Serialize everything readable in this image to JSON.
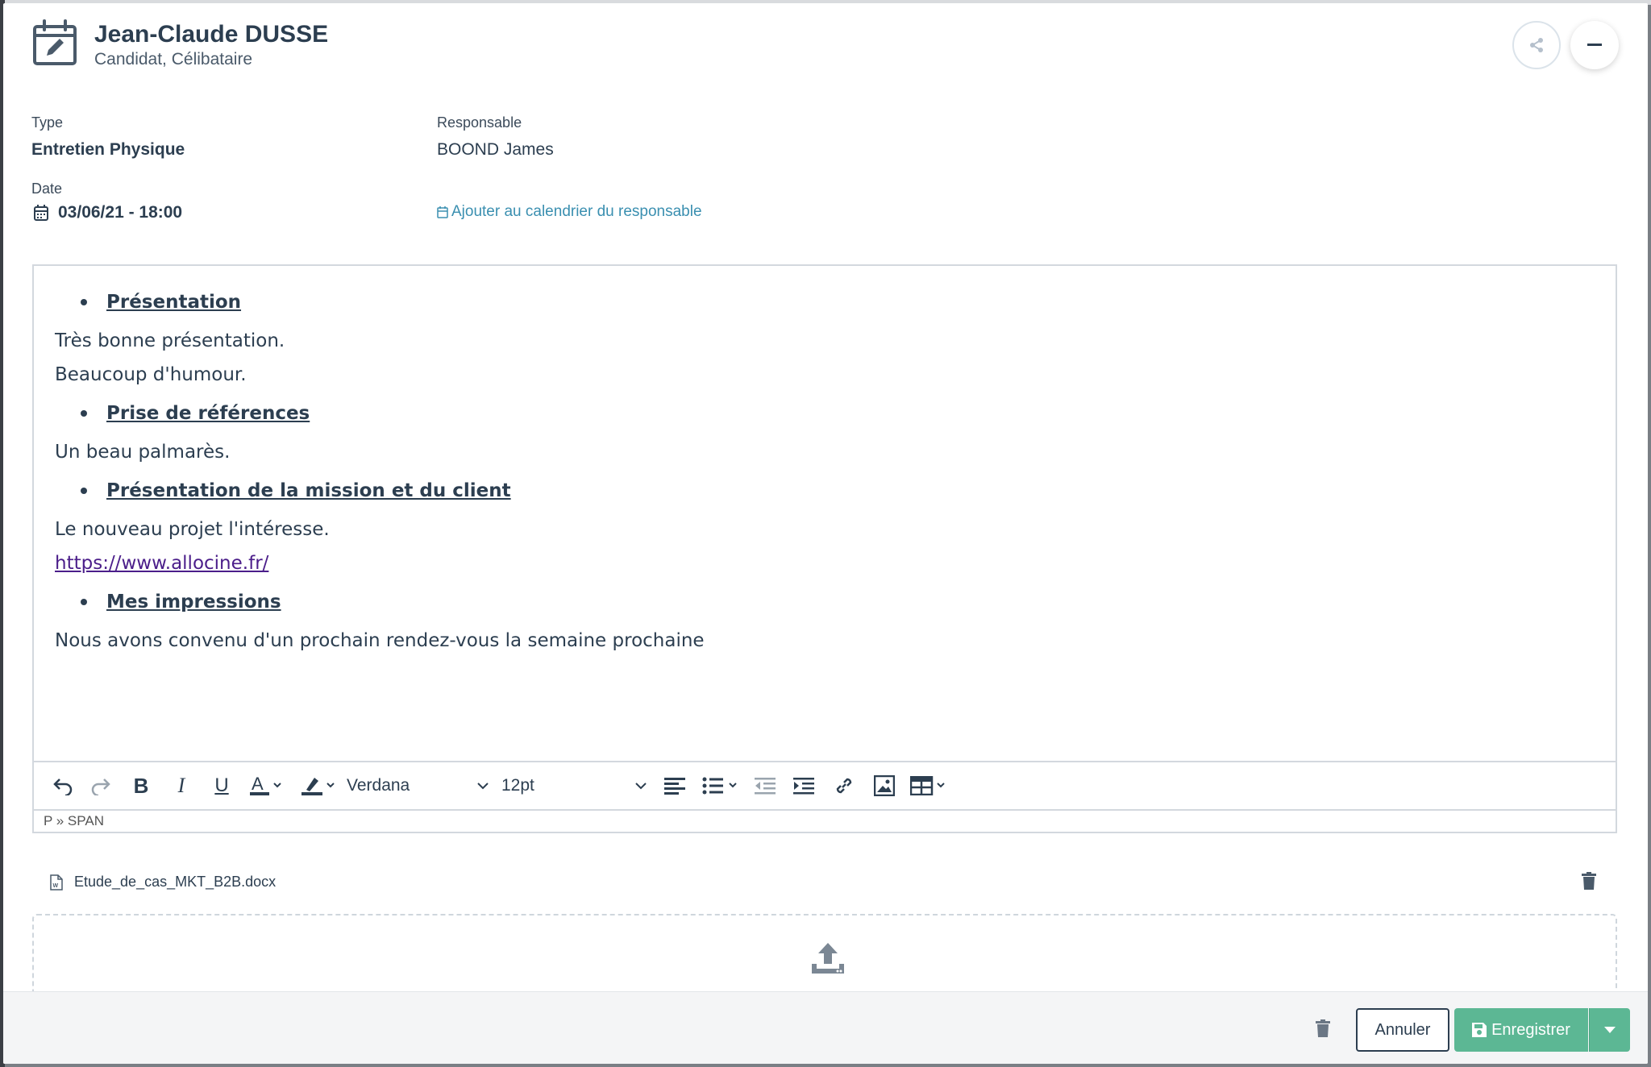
{
  "header": {
    "name": "Jean-Claude DUSSE",
    "subtitle": "Candidat, Célibataire"
  },
  "fields": {
    "type_label": "Type",
    "type_value": "Entretien Physique",
    "responsable_label": "Responsable",
    "responsable_value": "BOOND James",
    "date_label": "Date",
    "date_value": "03/06/21 - 18:00",
    "calendar_link": "Ajouter au calendrier du responsable"
  },
  "editor": {
    "sections": [
      {
        "heading": "Présentation",
        "lines": [
          "Très bonne présentation.",
          "Beaucoup d'humour."
        ]
      },
      {
        "heading": "Prise de références",
        "lines": [
          "Un beau palmarès."
        ]
      },
      {
        "heading": "Présentation de la mission et du client",
        "lines": [
          "Le nouveau projet l'intéresse."
        ],
        "link": "https://www.allocine.fr/"
      },
      {
        "heading": "Mes impressions",
        "lines": [
          "Nous avons convenu d'un prochain rendez-vous la semaine prochaine"
        ]
      }
    ],
    "toolbar": {
      "font_family": "Verdana",
      "font_size": "12pt"
    },
    "statusbar": "P » SPAN"
  },
  "attachment": {
    "filename": "Etude_de_cas_MKT_B2B.docx"
  },
  "footer": {
    "cancel_label": "Annuler",
    "save_label": "Enregistrer"
  },
  "colors": {
    "accent_green": "#5cb794",
    "link_blue": "#3a8fb0",
    "text_dark": "#2c3e50"
  }
}
